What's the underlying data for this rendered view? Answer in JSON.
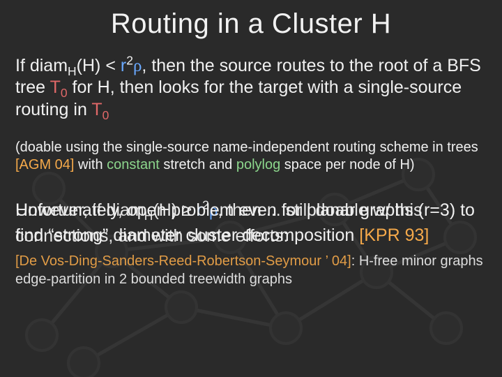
{
  "title": "Routing in a Cluster H",
  "p1": {
    "t1": "If diam",
    "subH": "H",
    "t2": "(H) < ",
    "r": "r",
    "sup2": "2",
    "rho": "ρ",
    "t3": ", then the source routes to the root of a BFS tree ",
    "T": "T",
    "sub0a": "0",
    "t4": " for H, then looks for the target with a single-source routing in ",
    "T2": "T",
    "sub0b": "0"
  },
  "p2": {
    "t1": "(doable using the single-source name-independent routing scheme in trees ",
    "cite": "[AGM 04]",
    "t2": " with ",
    "const": "constant",
    "t3": " stretch and ",
    "polylog": "polylog",
    "t4": " space per node of H)"
  },
  "ov": {
    "front": {
      "t1": "Unfortunately, open problem even for planar graphs (r=3) to find “strong” diameter cluster decomposition ",
      "cite": "[KPR 93]"
    },
    "back": {
      "t1": "However, if diam",
      "subH": "H",
      "t2": "(H) ≥ ",
      "r": "r",
      "sup2": "2",
      "rho": "ρ",
      "t3": ", then ... still doable w/ this connections, and with some efforts:"
    },
    "note": {
      "cite": "[De Vos-Ding-Sanders-Reed-Robertson-Seymour ’ 04]",
      "t1": ": H-free minor graphs edge-partition in 2 bounded treewidth graphs"
    }
  }
}
